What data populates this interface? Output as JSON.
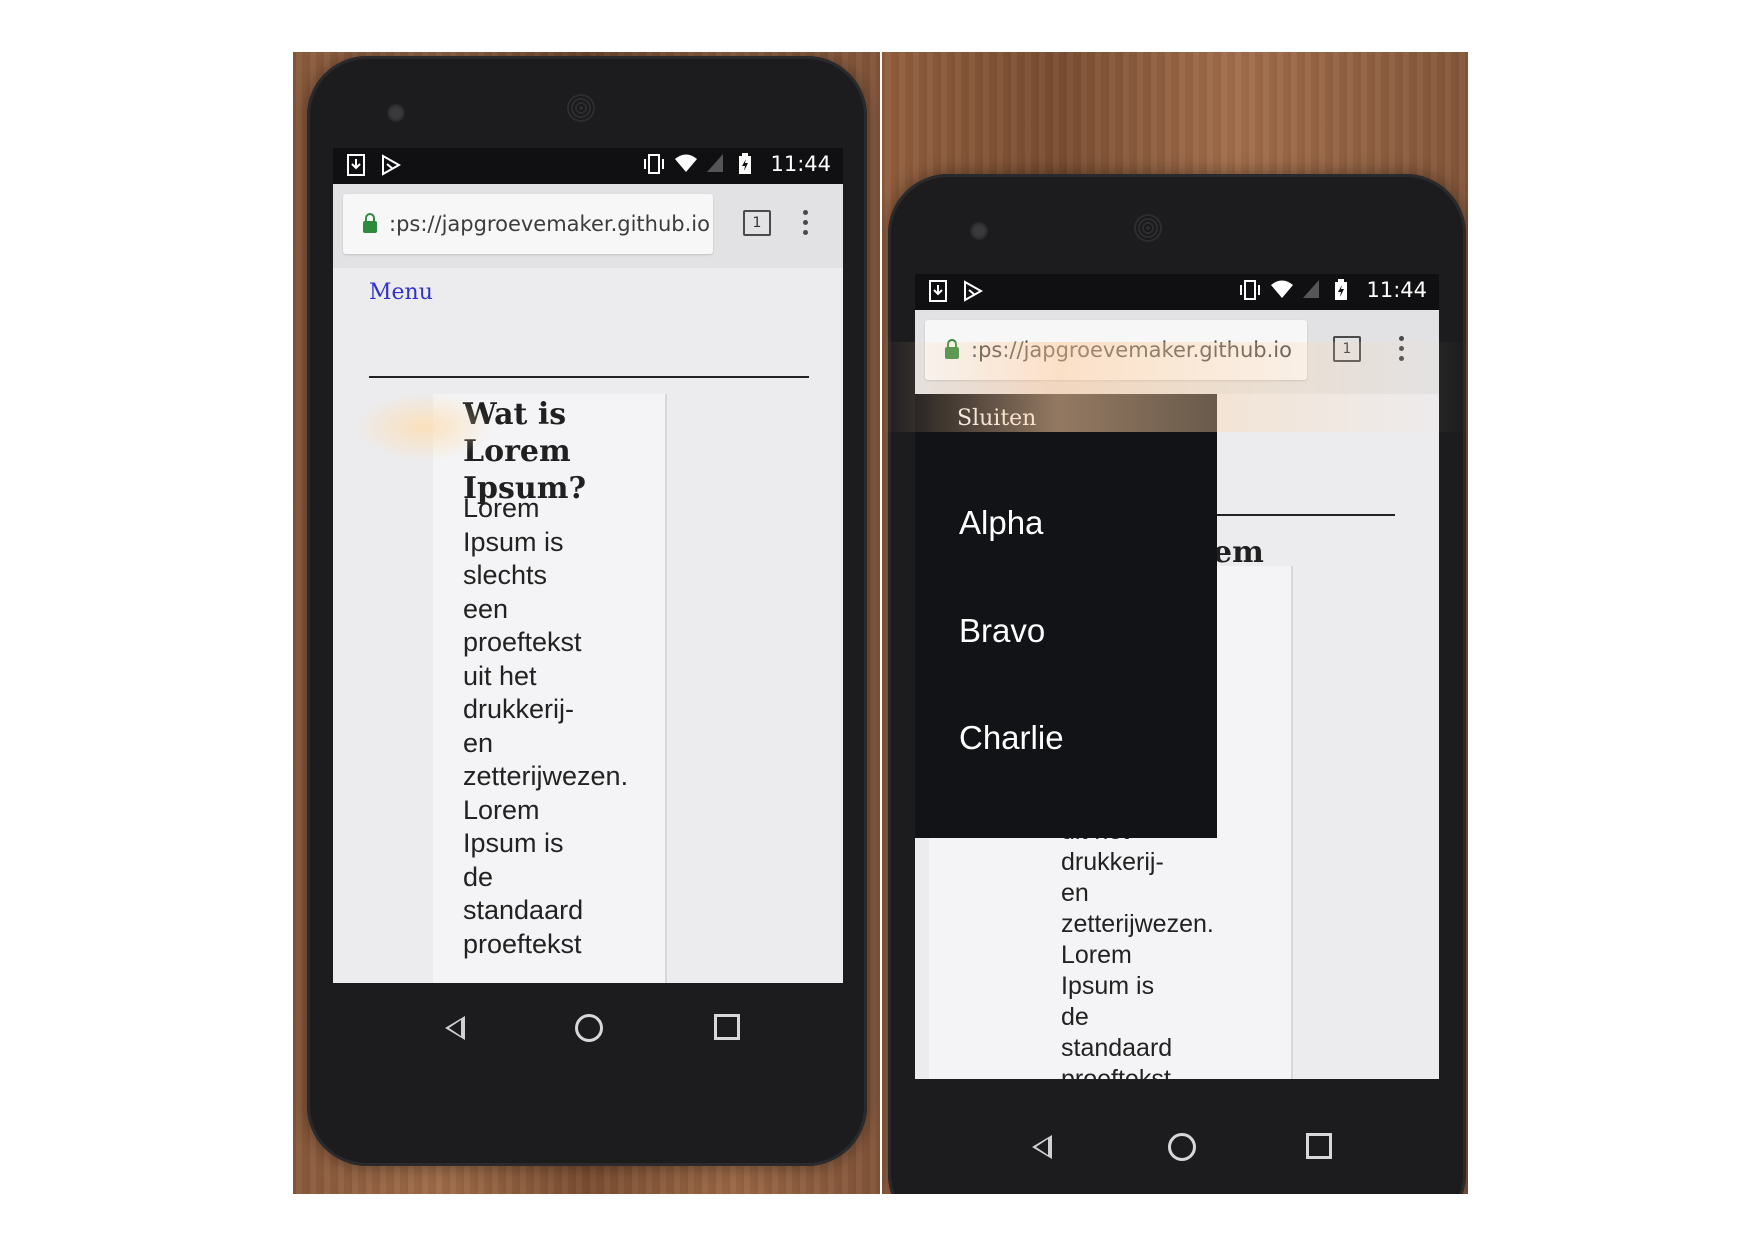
{
  "left": {
    "status": {
      "time": "11:44"
    },
    "address_bar": {
      "url": ":ps://japgroevemaker.github.io",
      "tab_count": "1"
    },
    "page": {
      "menu_link": "Menu",
      "article": {
        "heading_lines": [
          "Wat is Lorem",
          "Ipsum?"
        ],
        "body_lines": [
          "Lorem",
          "Ipsum is",
          "slechts",
          "een",
          "proeftekst",
          "uit het",
          "drukkerij-",
          "en",
          "zetterijwezen.",
          "Lorem",
          "Ipsum is",
          "de",
          "standaard",
          "proeftekst"
        ]
      }
    }
  },
  "right": {
    "status": {
      "time": "11:44"
    },
    "address_bar": {
      "url": ":ps://japgroevemaker.github.io",
      "tab_count": "1"
    },
    "page": {
      "heading_fragment": "em",
      "article": {
        "body_lines": [
          "uit het",
          "drukkerij-",
          "en",
          "zetterijwezen.",
          "Lorem",
          "Ipsum is",
          "de",
          "standaard",
          "proeftekst"
        ]
      }
    },
    "menu": {
      "close_label": "Sluiten",
      "items": [
        "Alpha",
        "Bravo",
        "Charlie"
      ]
    }
  }
}
